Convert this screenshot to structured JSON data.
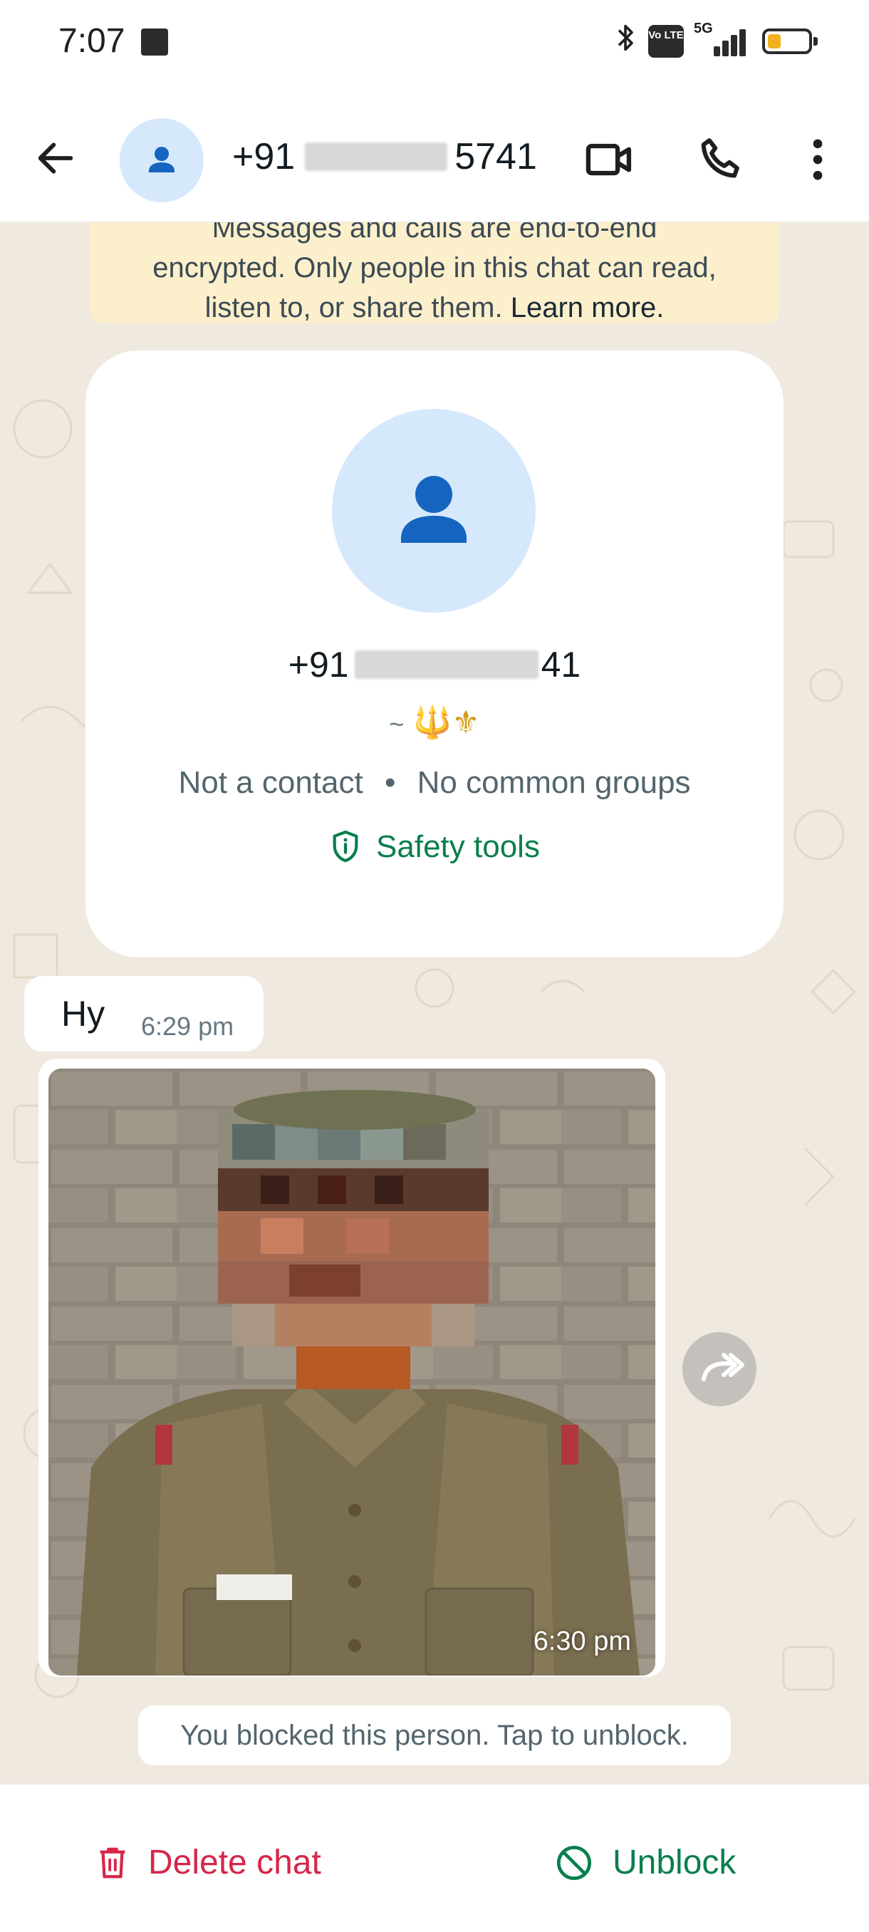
{
  "status_bar": {
    "time": "7:07",
    "network": "5G",
    "volte": "Vo LTE",
    "icons": [
      "notification-square-icon",
      "bluetooth-icon",
      "volte-icon",
      "signal-icon",
      "battery-icon"
    ]
  },
  "header": {
    "title_prefix": "+91",
    "title_suffix": "5741",
    "icons": [
      "back-arrow-icon",
      "avatar-person-icon",
      "video-call-icon",
      "voice-call-icon",
      "more-options-icon"
    ]
  },
  "encryption_notice": {
    "line1": "Messages and calls are end-to-end",
    "line2": "encrypted. Only people in this chat can read,",
    "line3_prefix": "listen to, or share them. ",
    "learn_more": "Learn more."
  },
  "profile_card": {
    "number_prefix": "+91",
    "number_suffix": "41",
    "about_tilde": "~",
    "about_emojis": "🔱⚜",
    "not_a_contact": "Not a contact",
    "separator": "•",
    "common_groups": "No common groups",
    "safety_tools": "Safety tools"
  },
  "messages": [
    {
      "type": "text",
      "text": "Hy",
      "time": "6:29 pm"
    },
    {
      "type": "image",
      "time": "6:30 pm"
    }
  ],
  "blocked_notice": "You blocked this person. Tap to unblock.",
  "bottom_bar": {
    "delete_label": "Delete chat",
    "unblock_label": "Unblock"
  },
  "colors": {
    "accent_green": "#0a7f4d",
    "danger_red": "#d6264a",
    "avatar_bg": "#d6e8fc",
    "avatar_fg": "#1565c0",
    "chat_bg": "#efe9df",
    "encryption_bg": "#fcefcc"
  }
}
